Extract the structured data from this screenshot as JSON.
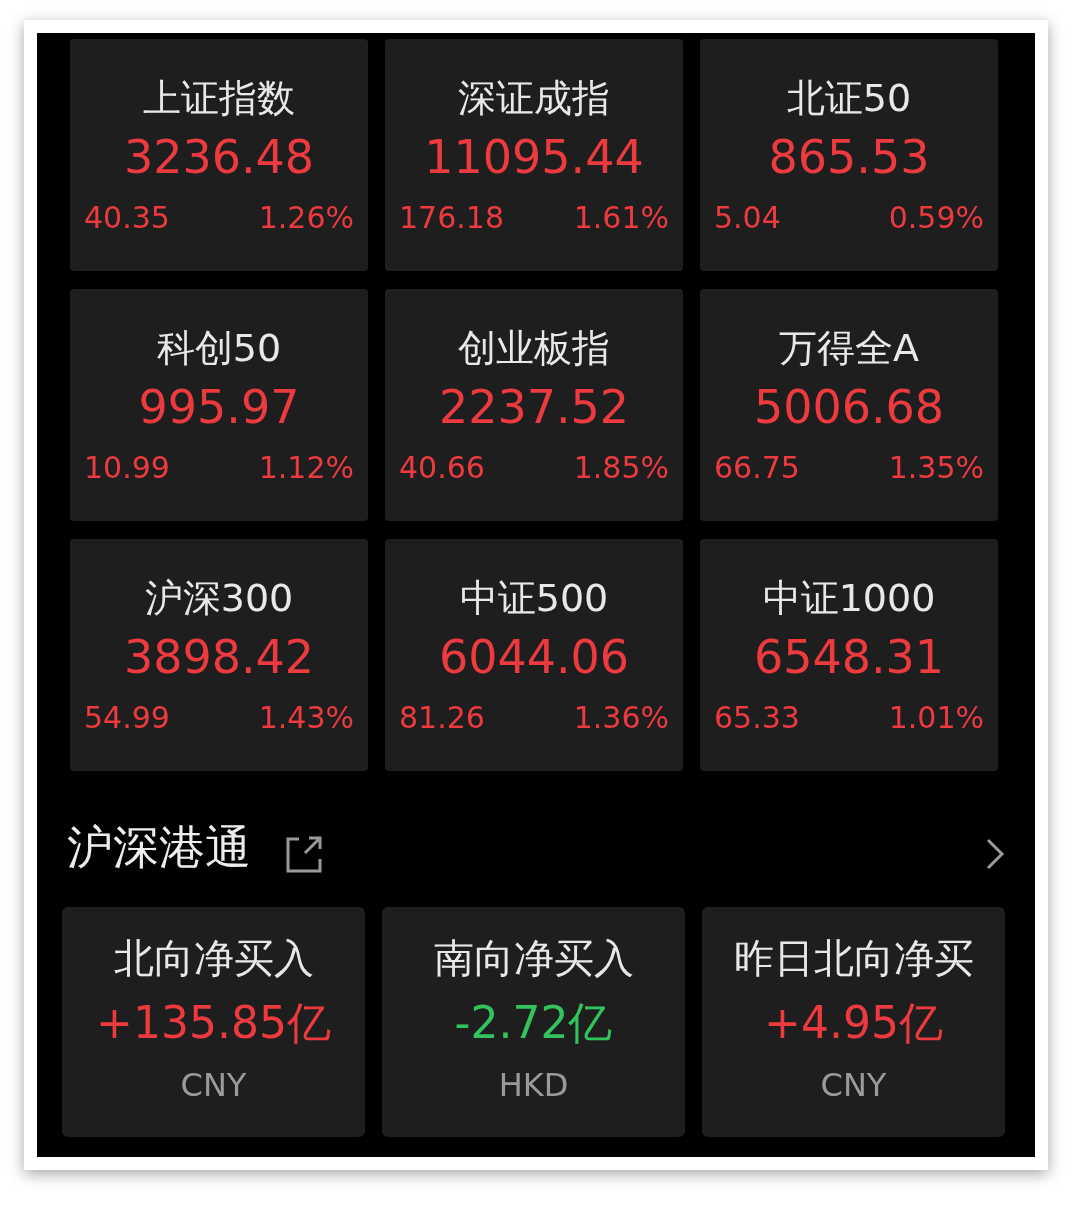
{
  "indices": [
    {
      "name": "上证指数",
      "value": "3236.48",
      "change": "40.35",
      "percent": "1.26%",
      "color": "#ec3a3f"
    },
    {
      "name": "深证成指",
      "value": "11095.44",
      "change": "176.18",
      "percent": "1.61%",
      "color": "#ec3a3f"
    },
    {
      "name": "北证50",
      "value": "865.53",
      "change": "5.04",
      "percent": "0.59%",
      "color": "#ec3a3f"
    },
    {
      "name": "科创50",
      "value": "995.97",
      "change": "10.99",
      "percent": "1.12%",
      "color": "#ec3a3f"
    },
    {
      "name": "创业板指",
      "value": "2237.52",
      "change": "40.66",
      "percent": "1.85%",
      "color": "#ec3a3f"
    },
    {
      "name": "万得全A",
      "value": "5006.68",
      "change": "66.75",
      "percent": "1.35%",
      "color": "#ec3a3f"
    },
    {
      "name": "沪深300",
      "value": "3898.42",
      "change": "54.99",
      "percent": "1.43%",
      "color": "#ec3a3f"
    },
    {
      "name": "中证500",
      "value": "6044.06",
      "change": "81.26",
      "percent": "1.36%",
      "color": "#ec3a3f"
    },
    {
      "name": "中证1000",
      "value": "6548.31",
      "change": "65.33",
      "percent": "1.01%",
      "color": "#ec3a3f"
    }
  ],
  "connect": {
    "title": "沪深港通",
    "flows": [
      {
        "name": "北向净买入",
        "value": "+135.85亿",
        "currency": "CNY",
        "color": "#ec3a3f"
      },
      {
        "name": "南向净买入",
        "value": "-2.72亿",
        "currency": "HKD",
        "color": "#33c35c"
      },
      {
        "name": "昨日北向净买",
        "value": "+4.95亿",
        "currency": "CNY",
        "color": "#ec3a3f"
      }
    ]
  }
}
